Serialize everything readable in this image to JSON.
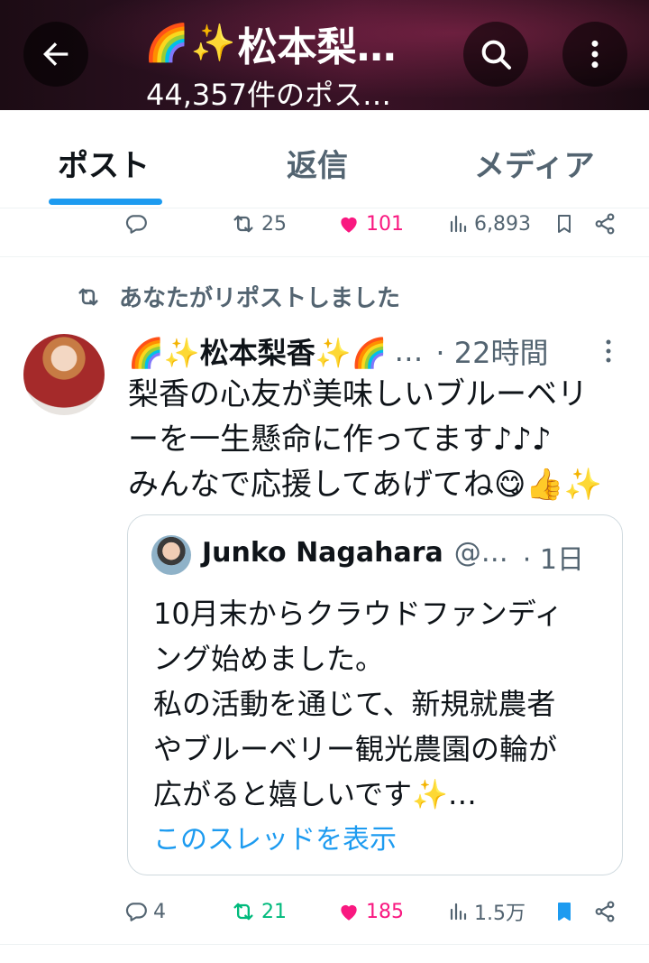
{
  "header": {
    "title": "松本梨…",
    "title_emojis": [
      "🌈",
      "✨"
    ],
    "subtitle": "44,357件のポス…"
  },
  "tabs": [
    {
      "label": "ポスト",
      "active": true
    },
    {
      "label": "返信",
      "active": false
    },
    {
      "label": "メディア",
      "active": false
    }
  ],
  "prev_tweet_actions": {
    "replies": "",
    "reposts": "25",
    "likes": "101",
    "views": "6,893"
  },
  "repost_indicator": "あなたがリポストしました",
  "tweet": {
    "author_prefix": "🌈✨",
    "author_name": "松本梨香",
    "author_suffix": "✨🌈",
    "author_ellipsis": "…",
    "time": "· 22時間",
    "text_lines": [
      "梨香の心友が美味しいブルーベリ",
      "ーを一生懸命に作ってます♪♪♪",
      "みんなで応援してあげてね😋👍✨"
    ],
    "quote": {
      "author_name": "Junko Nagahara",
      "handle": "@…",
      "time": "· 1日",
      "text_lines": [
        "10月末からクラウドファンディ",
        "ング始めました。",
        "私の活動を通じて、新規就農者",
        "やブルーベリー観光農園の輪が",
        "広がると嬉しいです✨…"
      ],
      "show_thread": "このスレッドを表示"
    },
    "actions": {
      "replies": "4",
      "reposts": "21",
      "likes": "185",
      "views": "1.5万"
    }
  },
  "colors": {
    "accent": "#1d9bf0",
    "like": "#f91880",
    "repost": "#00ba7c",
    "muted": "#536471"
  }
}
